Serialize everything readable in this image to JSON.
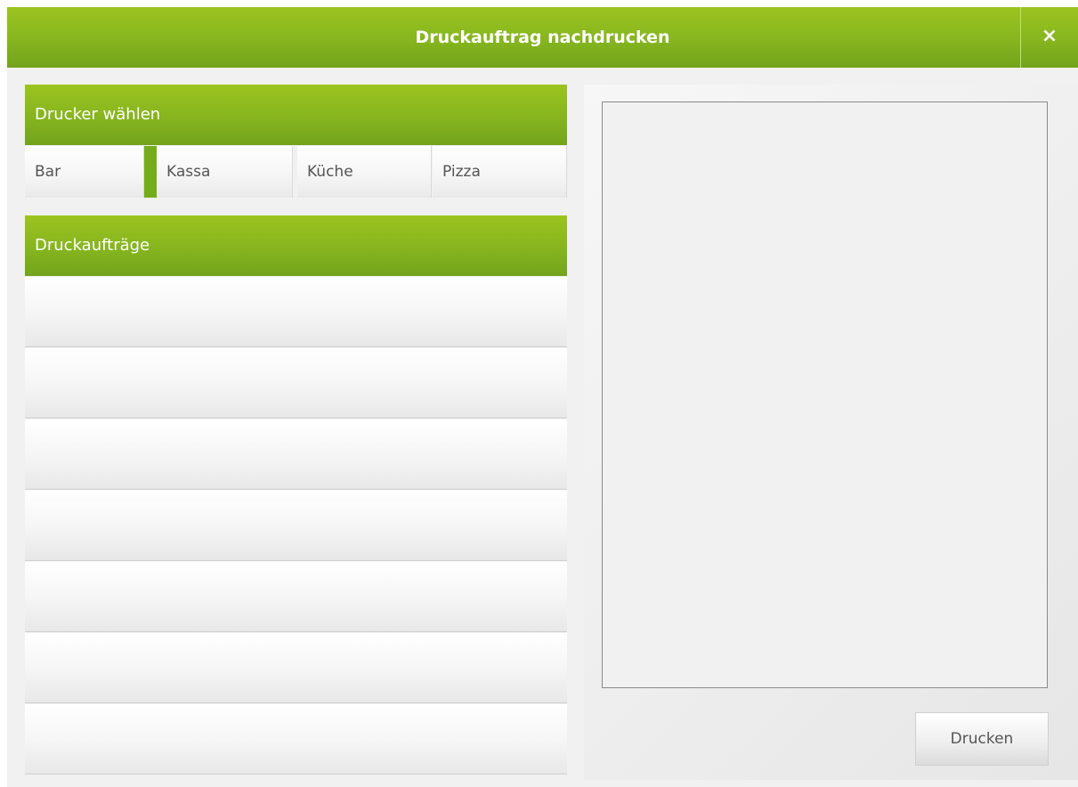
{
  "dialog": {
    "title": "Druckauftrag nachdrucken",
    "close_icon": "close-icon",
    "close_glyph": "×"
  },
  "printers": {
    "header": "Drucker wählen",
    "items": [
      {
        "label": "Bar",
        "selected": false
      },
      {
        "label": "Kassa",
        "selected": true
      },
      {
        "label": "Küche",
        "selected": false
      },
      {
        "label": "Pizza",
        "selected": false
      }
    ]
  },
  "jobs": {
    "header": "Druckaufträge",
    "rows": [
      "",
      "",
      "",
      "",
      "",
      "",
      ""
    ]
  },
  "preview": {
    "print_button": "Drucken"
  },
  "colors": {
    "accent_green": "#86b51f",
    "selected_marker": "#75ad1a"
  }
}
